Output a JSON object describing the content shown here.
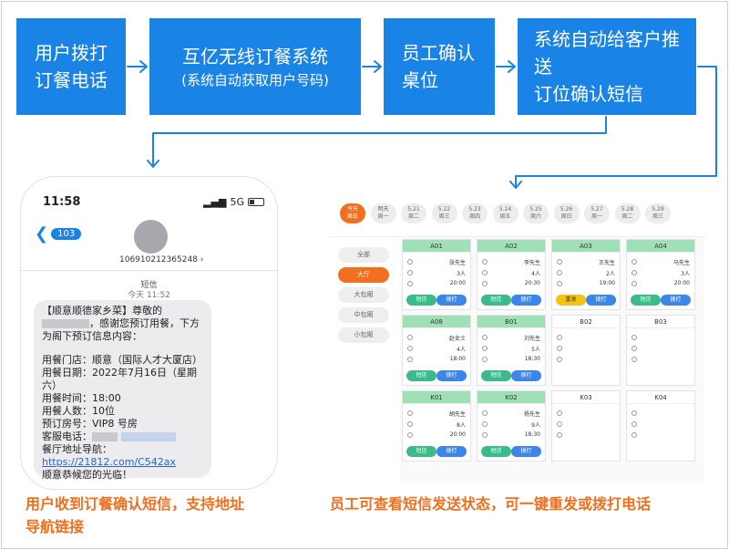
{
  "flow": {
    "step1": {
      "line1": "用户拨打",
      "line2": "订餐电话"
    },
    "step2": {
      "line1": "互亿无线订餐系统",
      "line2": "(系统自动获取用户号码)"
    },
    "step3": {
      "line1": "员工确认",
      "line2": "桌位"
    },
    "step4": {
      "line1": "系统自动给客户推送",
      "line2": "订位确认短信"
    },
    "color": "#1a83e6"
  },
  "phone": {
    "time": "11:58",
    "signal": "5G",
    "back_badge": "103",
    "number": "106910212365248",
    "sms_label": "短信",
    "sms_time": "今天 11:52",
    "message": {
      "p1a": "【顺意顺德家乡菜】尊敬的",
      "p1b": "，感谢您预订用餐，下方为阁下预订信息内容：",
      "store": "用餐门店：顺意（国际人才大厦店）",
      "date": "用餐日期：2022年7月16日（星期六）",
      "time": "用餐时间：18:00",
      "people": "用餐人数：10位",
      "room": "预订房号：VIP8 号房",
      "service": "客服电话：",
      "nav_label": "餐厅地址导航：",
      "nav_link": "https://21812.com/C542ax",
      "closing": "顺意恭候您的光临！"
    }
  },
  "captions": {
    "left": [
      "用户收到订餐确认短信，支持地址",
      "导航链接"
    ],
    "right": "员工可查看短信发送状态，可一键重发或拨打电话",
    "color": "#f06e1c"
  },
  "app": {
    "days": [
      {
        "top": "今天",
        "bottom": "周日",
        "active": true
      },
      {
        "top": "明天",
        "bottom": "周一"
      },
      {
        "top": "5.21",
        "bottom": "周二"
      },
      {
        "top": "5.22",
        "bottom": "周三"
      },
      {
        "top": "5.23",
        "bottom": "周四"
      },
      {
        "top": "5.24",
        "bottom": "周五"
      },
      {
        "top": "5.25",
        "bottom": "周六"
      },
      {
        "top": "5.26",
        "bottom": "周日"
      },
      {
        "top": "5.27",
        "bottom": "周一"
      },
      {
        "top": "5.28",
        "bottom": "周二"
      },
      {
        "top": "5.29",
        "bottom": "周三"
      }
    ],
    "halls": [
      {
        "label": "全部"
      },
      {
        "label": "大厅",
        "active": true
      },
      {
        "label": "大包厢"
      },
      {
        "label": "中包厢"
      },
      {
        "label": "小包厢"
      }
    ],
    "tables": [
      {
        "id": "A01",
        "occupied": true,
        "name": "张先生",
        "people": "3人",
        "time": "20:00",
        "left_btn": "短信",
        "right_btn": "拨打"
      },
      {
        "id": "A02",
        "occupied": true,
        "name": "李先生",
        "people": "4人",
        "time": "20:30",
        "left_btn": "短信",
        "right_btn": "拨打"
      },
      {
        "id": "A03",
        "occupied": true,
        "name": "王先生",
        "people": "2人",
        "time": "19:00",
        "left_btn": "重发",
        "right_btn": "拨打",
        "warn": true
      },
      {
        "id": "A04",
        "occupied": true,
        "name": "马先生",
        "people": "3人",
        "time": "20:00",
        "left_btn": "短信",
        "right_btn": "拨打"
      },
      {
        "id": "A08",
        "occupied": true,
        "name": "赵女士",
        "people": "4人",
        "time": "18:00",
        "left_btn": "短信",
        "right_btn": "拨打"
      },
      {
        "id": "B01",
        "occupied": true,
        "name": "刘先生",
        "people": "5人",
        "time": "18:30",
        "left_btn": "短信",
        "right_btn": "拨打"
      },
      {
        "id": "B02",
        "occupied": false
      },
      {
        "id": "B03",
        "occupied": false
      },
      {
        "id": "K01",
        "occupied": true,
        "name": "胡先生",
        "people": "8人",
        "time": "20:00",
        "left_btn": "短信",
        "right_btn": "拨打"
      },
      {
        "id": "K02",
        "occupied": true,
        "name": "杨先生",
        "people": "9人",
        "time": "18:30",
        "left_btn": "短信",
        "right_btn": "拨打"
      },
      {
        "id": "K03",
        "occupied": false
      },
      {
        "id": "K04",
        "occupied": false
      }
    ]
  }
}
